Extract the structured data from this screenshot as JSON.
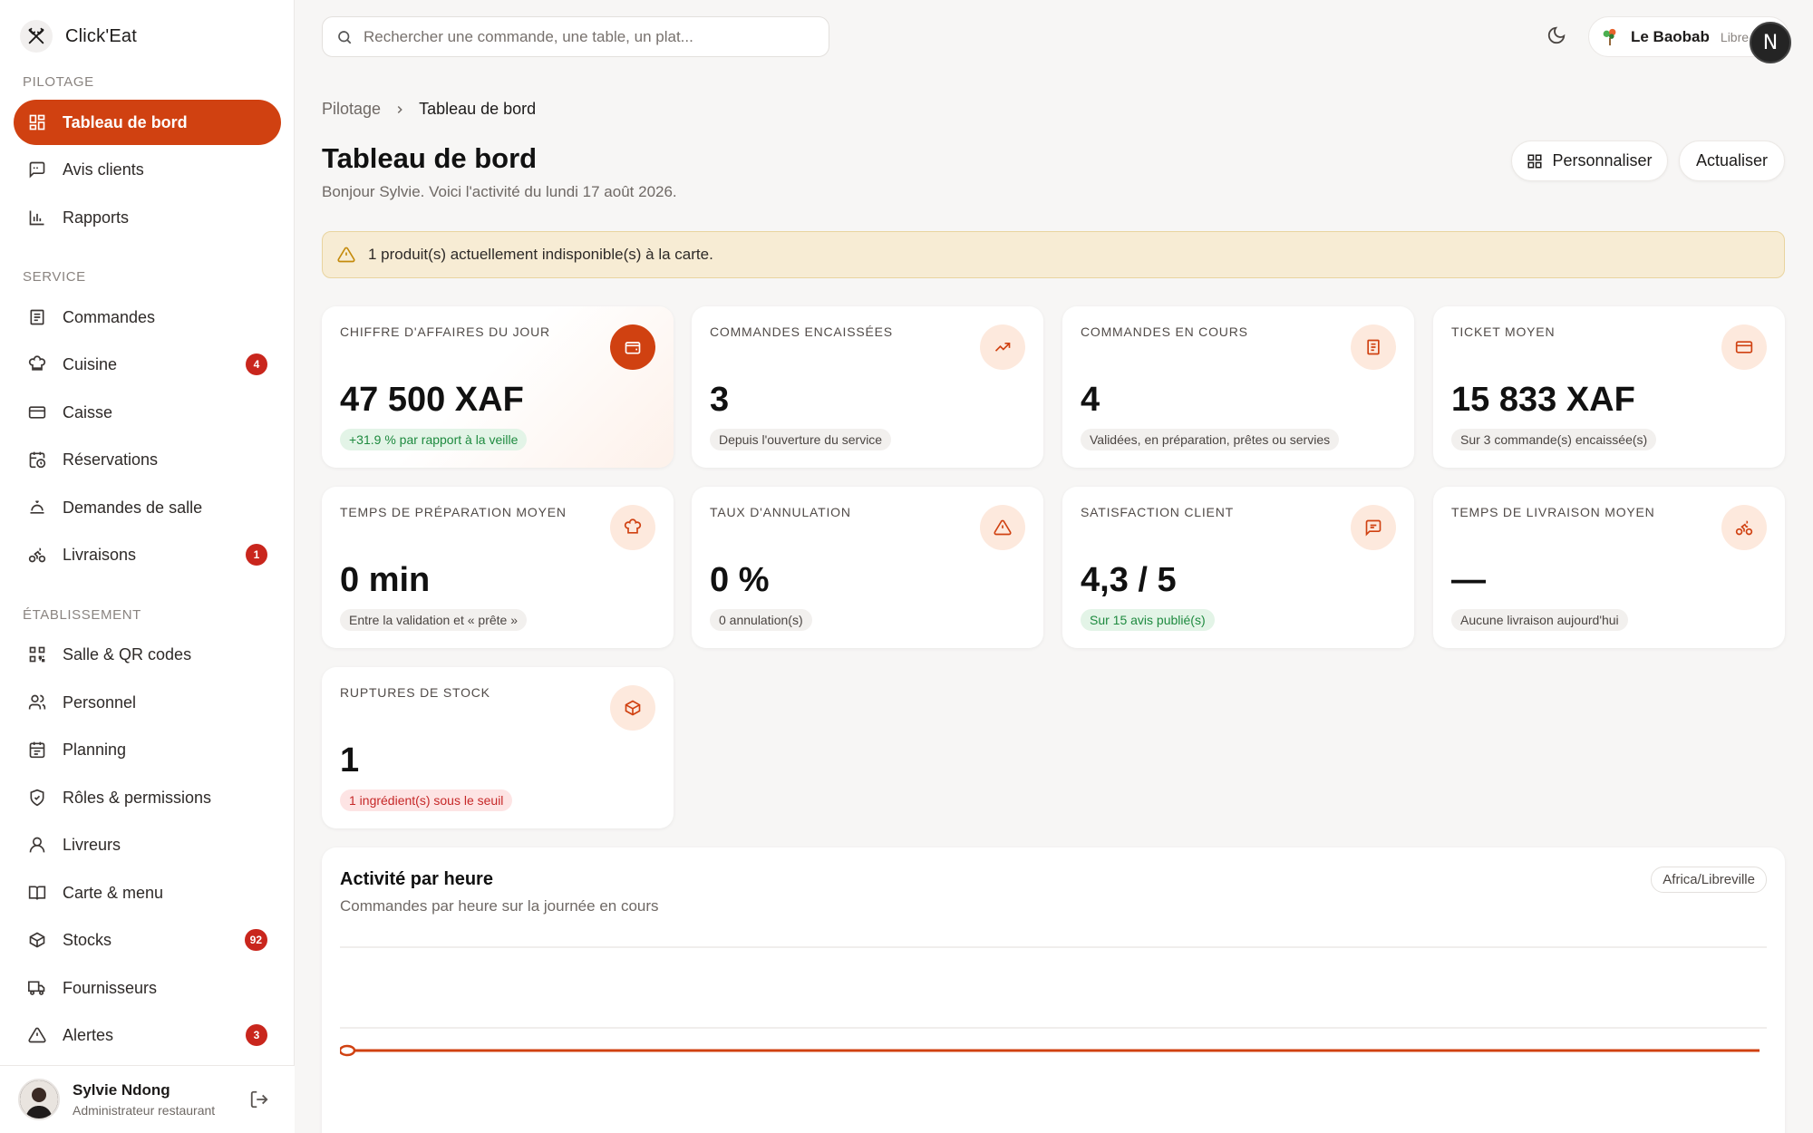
{
  "brand": {
    "name": "Click'Eat"
  },
  "sidebar": {
    "sections": [
      {
        "title": "Pilotage"
      },
      {
        "title": "Service"
      },
      {
        "title": "Établissement"
      }
    ],
    "items": [
      {
        "label": "Tableau de bord",
        "icon": "dashboard-icon"
      },
      {
        "label": "Avis clients",
        "icon": "reviews-icon"
      },
      {
        "label": "Rapports",
        "icon": "reports-icon"
      },
      {
        "label": "Commandes",
        "icon": "orders-icon"
      },
      {
        "label": "Cuisine",
        "icon": "chef-hat-icon",
        "badge": "4"
      },
      {
        "label": "Caisse",
        "icon": "cash-register-icon"
      },
      {
        "label": "Réservations",
        "icon": "calendar-clock-icon"
      },
      {
        "label": "Demandes de salle",
        "icon": "service-bell-icon"
      },
      {
        "label": "Livraisons",
        "icon": "bike-icon",
        "badge": "1"
      },
      {
        "label": "Salle & QR codes",
        "icon": "qr-code-icon"
      },
      {
        "label": "Personnel",
        "icon": "users-icon"
      },
      {
        "label": "Planning",
        "icon": "calendar-icon"
      },
      {
        "label": "Rôles & permissions",
        "icon": "shield-icon"
      },
      {
        "label": "Livreurs",
        "icon": "user-icon"
      },
      {
        "label": "Carte & menu",
        "icon": "book-icon"
      },
      {
        "label": "Stocks",
        "icon": "box-icon",
        "badge": "92"
      },
      {
        "label": "Fournisseurs",
        "icon": "truck-icon"
      },
      {
        "label": "Alertes",
        "icon": "warning-icon",
        "badge": "3"
      }
    ],
    "user": {
      "name": "Sylvie Ndong",
      "role": "Administrateur restaurant"
    }
  },
  "topbar": {
    "search_placeholder": "Rechercher une commande, une table, un plat...",
    "restaurant_name": "Le Baobab",
    "restaurant_city": "Libre",
    "account_initial": "N"
  },
  "breadcrumb": {
    "parent": "Pilotage",
    "current": "Tableau de bord"
  },
  "header": {
    "title": "Tableau de bord",
    "subtitle": "Bonjour Sylvie. Voici l'activité du lundi 17 août 2026.",
    "customize_label": "Personnaliser",
    "refresh_label": "Actualiser"
  },
  "alert": {
    "text": "1 produit(s) actuellement indisponible(s) à la carte."
  },
  "kpis": [
    {
      "label": "Chiffre d'affaires du jour",
      "value": "47 500 XAF",
      "note": "+31.9 % par rapport à la veille",
      "icon": "wallet-icon"
    },
    {
      "label": "Commandes encaissées",
      "value": "3",
      "note": "Depuis l'ouverture du service",
      "icon": "trending-up-icon"
    },
    {
      "label": "Commandes en cours",
      "value": "4",
      "note": "Validées, en préparation, prêtes ou servies",
      "icon": "receipt-icon"
    },
    {
      "label": "Ticket moyen",
      "value": "15 833 XAF",
      "note": "Sur 3 commande(s) encaissée(s)",
      "icon": "credit-card-icon"
    },
    {
      "label": "Temps de préparation moyen",
      "value": "0 min",
      "note": "Entre la validation et « prête »",
      "icon": "chef-hat-icon"
    },
    {
      "label": "Taux d'annulation",
      "value": "0 %",
      "note": "0 annulation(s)",
      "icon": "warning-icon"
    },
    {
      "label": "Satisfaction client",
      "value": "4,3 / 5",
      "note": "Sur 15 avis publié(s)",
      "icon": "message-icon"
    },
    {
      "label": "Temps de livraison moyen",
      "value": "—",
      "note": "Aucune livraison aujourd'hui",
      "icon": "bike-icon"
    },
    {
      "label": "Ruptures de stock",
      "value": "1",
      "note": "1 ingrédient(s) sous le seuil",
      "icon": "box-icon"
    }
  ],
  "activity": {
    "title": "Activité par heure",
    "subtitle": "Commandes par heure sur la journée en cours",
    "timezone": "Africa/Libreville"
  },
  "colors": {
    "accent": "#d04111",
    "badge": "#c9261d",
    "alert_bg": "#f7ecd4"
  }
}
